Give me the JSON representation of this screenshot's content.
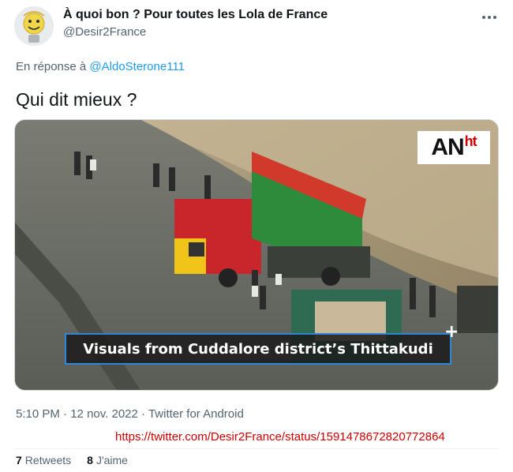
{
  "author": {
    "display_name": "À quoi bon ? Pour toutes les Lola de France",
    "handle": "@Desir2France",
    "avatar_icon": "smiley-face-avatar"
  },
  "reply": {
    "prefix": "En réponse à",
    "mention": "@AldoSterone111"
  },
  "tweet": {
    "text": "Qui dit mieux ?"
  },
  "media": {
    "logo_main": "AN",
    "logo_sup": "ht",
    "caption": "Visuals from Cuddalore district’s Thittakudi",
    "caption_plus": "+",
    "accent_color": "#2f86d6"
  },
  "meta": {
    "time": "5:10 PM",
    "separator": "·",
    "date": "12 nov. 2022",
    "source": "Twitter for Android"
  },
  "annotation_url": "https://twitter.com/Desir2France/status/1591478672820772864",
  "stats": {
    "retweets_count": "7",
    "retweets_label": "Retweets",
    "likes_count": "8",
    "likes_label": "J'aime"
  },
  "icons": {
    "more": "more-options-icon"
  }
}
